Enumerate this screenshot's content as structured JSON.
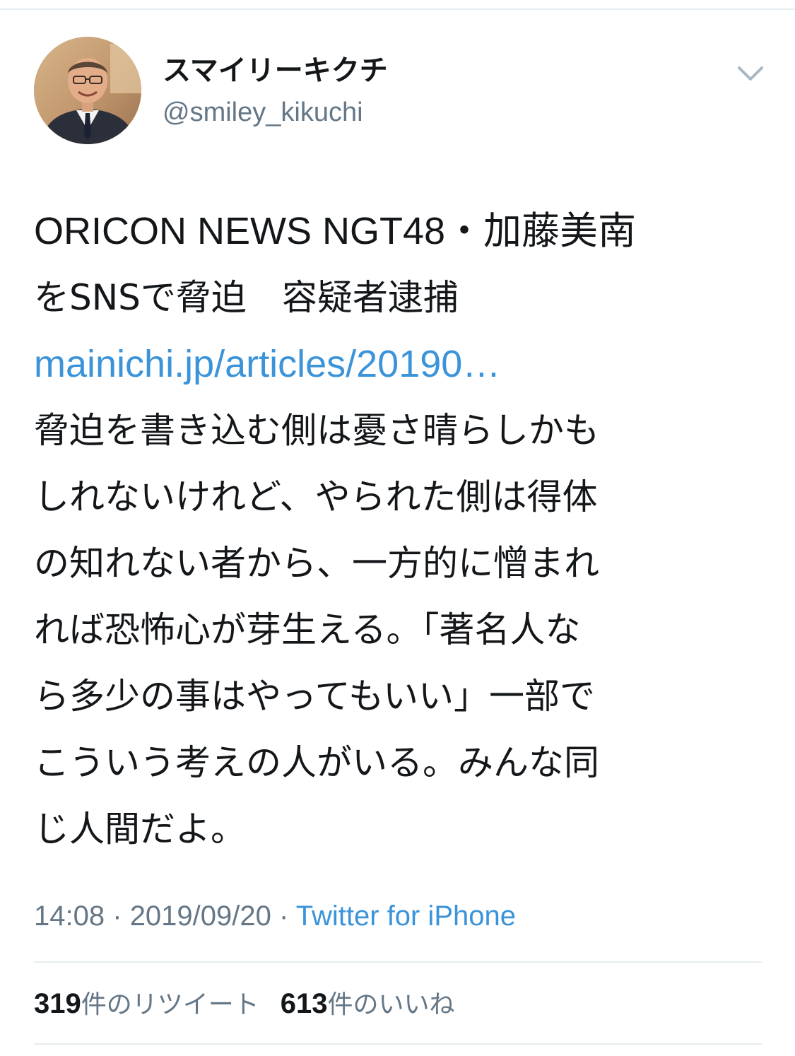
{
  "author": {
    "display_name": "スマイリーキクチ",
    "handle": "@smiley_kikuchi",
    "avatar_icon": "profile-photo"
  },
  "menu": {
    "icon": "chevron-down-icon",
    "color": "#aab8c2"
  },
  "tweet": {
    "lines": [
      "ORICON NEWS NGT48・加藤美南",
      "をSNSで脅迫　容疑者逮捕"
    ],
    "link": "mainichi.jp/articles/20190…",
    "body_lines": [
      "脅迫を書き込む側は憂さ晴らしかも",
      "しれないけれど、やられた側は得体",
      "の知れない者から、一方的に憎まれ",
      "れば恐怖心が芽生える。「著名人な",
      "ら多少の事はやってもいい」一部で",
      "こういう考えの人がいる。みんな同",
      "じ人間だよ。"
    ]
  },
  "meta": {
    "time": "14:08",
    "separator": "·",
    "date": "2019/09/20",
    "source": "Twitter for iPhone"
  },
  "stats": {
    "retweet_count": "319",
    "retweet_label": "件のリツイート",
    "like_count": "613",
    "like_label": "件のいいね"
  },
  "colors": {
    "text": "#14171a",
    "secondary": "#657786",
    "link": "#3b94d9",
    "divider": "#e6ecf0"
  }
}
